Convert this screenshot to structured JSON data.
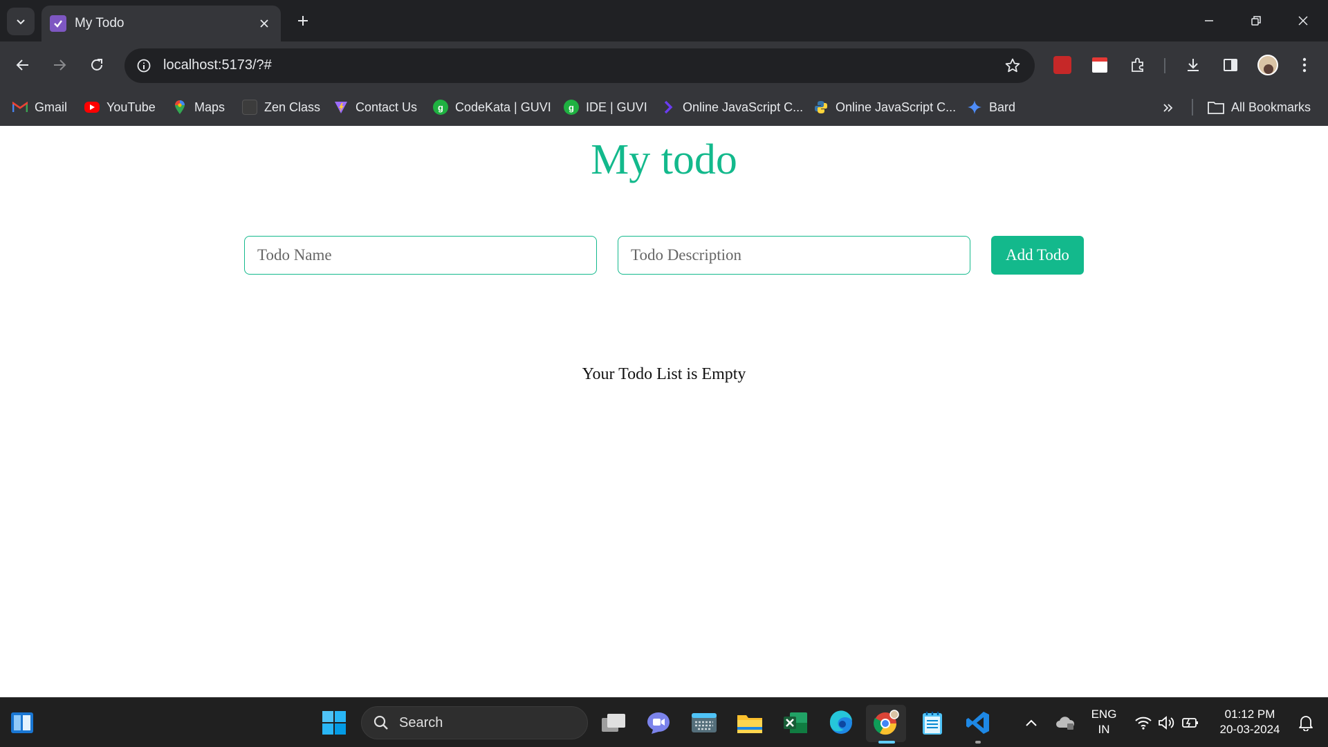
{
  "browser": {
    "tab_title": "My Todo",
    "url": "localhost:5173/?#",
    "bookmarks": [
      {
        "label": "Gmail",
        "icon": "gmail-icon",
        "color": "#ea4335"
      },
      {
        "label": "YouTube",
        "icon": "youtube-icon",
        "color": "#ff0000"
      },
      {
        "label": "Maps",
        "icon": "maps-icon",
        "color": "#34a853"
      },
      {
        "label": "Zen Class",
        "icon": "zen-class-icon",
        "color": "#555555"
      },
      {
        "label": "Contact Us",
        "icon": "vite-icon",
        "color": "#9c6cff"
      },
      {
        "label": "CodeKata | GUVI",
        "icon": "guvi-icon",
        "color": "#1fb141"
      },
      {
        "label": "IDE | GUVI",
        "icon": "guvi-icon",
        "color": "#1fb141"
      },
      {
        "label": "Online JavaScript C...",
        "icon": "programiz-icon",
        "color": "#6a3cf0"
      },
      {
        "label": "Online JavaScript C...",
        "icon": "python-icon",
        "color": "#3776ab"
      },
      {
        "label": "Bard",
        "icon": "bard-icon",
        "color": "#4e8cf7"
      }
    ],
    "all_bookmarks": "All Bookmarks"
  },
  "app": {
    "title": "My todo",
    "name_placeholder": "Todo Name",
    "description_placeholder": "Todo Description",
    "add_button": "Add Todo",
    "empty_message": "Your Todo List is Empty",
    "accent_color": "#13b98c"
  },
  "taskbar": {
    "search_label": "Search",
    "language": "ENG",
    "region": "IN",
    "time": "01:12 PM",
    "date": "20-03-2024"
  }
}
